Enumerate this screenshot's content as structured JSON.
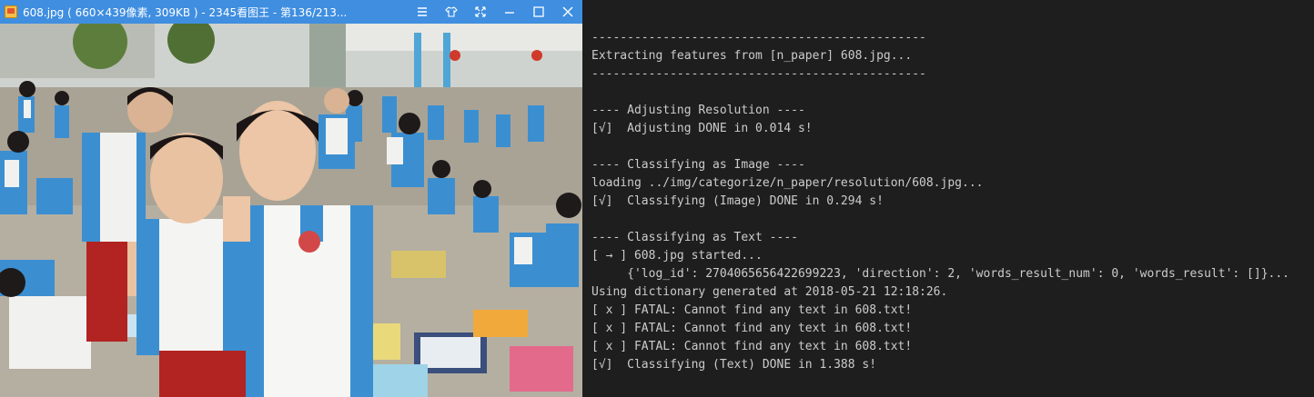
{
  "viewer": {
    "title": "608.jpg ( 660×439像素, 309KB ) - 2345看图王 - 第136/213...",
    "buttons": {
      "menu": "menu-icon",
      "skin": "shirt-icon",
      "fullscreen": "expand-icon",
      "minimize": "minimize-icon",
      "maximize": "maximize-icon",
      "close": "close-icon"
    },
    "titlebar_color": "#3f8ee0"
  },
  "terminal": {
    "lines": [
      "-----------------------------------------------",
      "Extracting features from [n_paper] 608.jpg...",
      "-----------------------------------------------",
      "",
      "---- Adjusting Resolution ----",
      "[√]  Adjusting DONE in 0.014 s!",
      "",
      "---- Classifying as Image ----",
      "loading ../img/categorize/n_paper/resolution/608.jpg...",
      "[√]  Classifying (Image) DONE in 0.294 s!",
      "",
      "---- Classifying as Text ----",
      "[ → ] 608.jpg started...",
      "     {'log_id': 2704065656422699223, 'direction': 2, 'words_result_num': 0, 'words_result': []}...",
      "Using dictionary generated at 2018-05-21 12:18:26.",
      "[ x ] FATAL: Cannot find any text in 608.txt!",
      "[ x ] FATAL: Cannot find any text in 608.txt!",
      "[ x ] FATAL: Cannot find any text in 608.txt!",
      "[√]  Classifying (Text) DONE in 1.388 s!"
    ],
    "background": "#1e1e1e",
    "text_color": "#cccccc"
  }
}
